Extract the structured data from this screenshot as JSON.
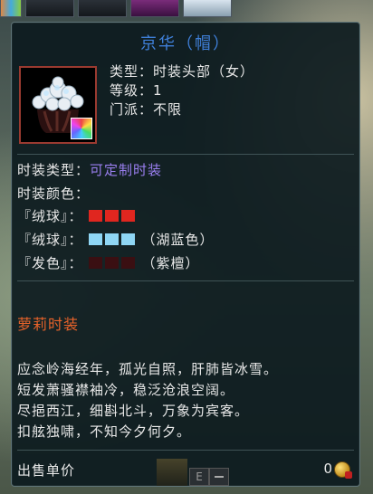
{
  "tooltip": {
    "title": "京华（帽）",
    "stats": [
      "类型：时装头部（女）",
      "等级：1",
      "门派：不限"
    ],
    "fashion_type_label": "时装类型：",
    "fashion_type_value": "可定制时装",
    "fashion_color_label": "时装颜色：",
    "color_rows": [
      {
        "label": "『绒球』：",
        "colors": [
          "#e0261f",
          "#e0261f",
          "#e0261f"
        ],
        "name": ""
      },
      {
        "label": "『绒球』：",
        "colors": [
          "#8fd6f4",
          "#8fd6f4",
          "#8fd6f4"
        ],
        "name": "（湖蓝色）"
      },
      {
        "label": "『发色』：",
        "colors": [
          "#3a0f12",
          "#3a0f12",
          "#3a0f12"
        ],
        "name": "（紫檀）"
      }
    ],
    "set_name": "萝莉时装",
    "poem": [
      "应念岭海经年，孤光自照，肝肺皆冰雪。",
      "短发萧骚襟袖冷，稳泛沧浪空阔。",
      "尽挹西江，细斟北斗，万象为宾客。",
      "扣舷独啸，不知今夕何夕。"
    ],
    "sell_label": "出售单价",
    "sell_price": "0",
    "icons": {
      "item": "hat-icon",
      "dye_badge": "dye-badge-icon",
      "coin": "coin-icon"
    },
    "colors": {
      "title": "#3f7fd8",
      "accent": "#9a7ff0",
      "set_name": "#e8632a"
    }
  },
  "hotbar_button_label": "E"
}
